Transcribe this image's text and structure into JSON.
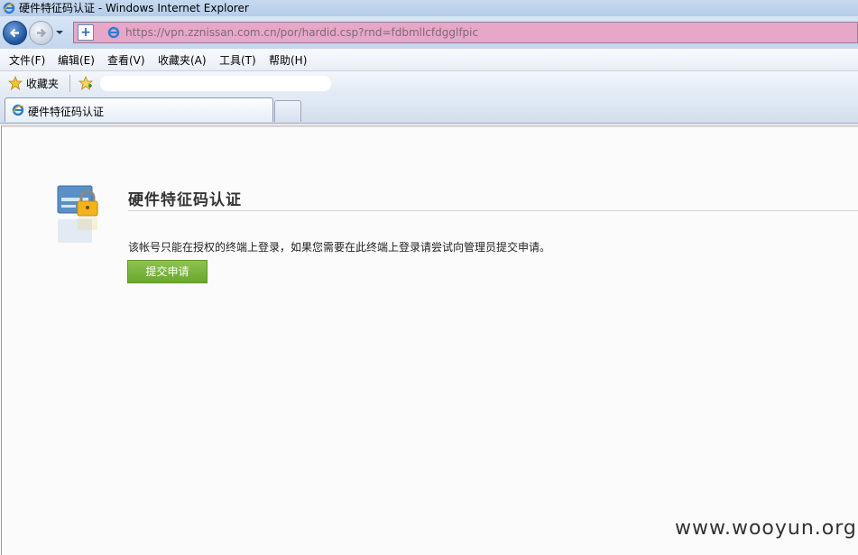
{
  "window": {
    "title": "硬件特征码认证 - Windows Internet Explorer"
  },
  "address": {
    "url": "https://vpn.zznissan.com.cn/por/hardid.csp?rnd=fdbmllcfdgglfpic"
  },
  "menu": [
    "文件(F)",
    "编辑(E)",
    "查看(V)",
    "收藏夹(A)",
    "工具(T)",
    "帮助(H)"
  ],
  "favorites": {
    "label": "收藏夹"
  },
  "tab": {
    "label": "硬件特征码认证"
  },
  "page": {
    "heading": "硬件特征码认证",
    "message": "该帐号只能在授权的终端上登录，如果您需要在此终端上登录请尝试向管理员提交申请。",
    "submit_label": "提交申请"
  },
  "watermark": "www.wooyun.org",
  "colors": {
    "address_bar": "#e7a7c9",
    "submit_button": "#7ab53b",
    "title_bar": "#c6d9ef"
  },
  "icons": {
    "browser": "ie-icon",
    "security": "shield-icon",
    "lock": "lock-icon",
    "favorites": "star-icon"
  }
}
